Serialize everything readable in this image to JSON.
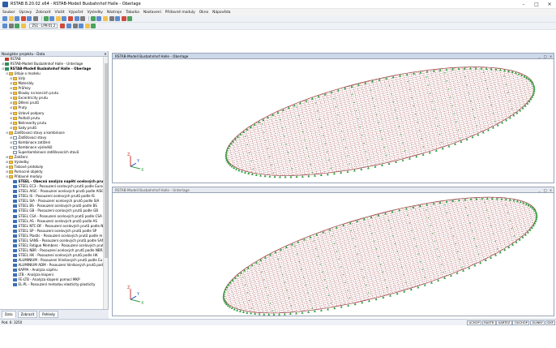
{
  "window": {
    "title": "RSTAB 8.20.02 x64 - RSTAB-Modell Busbahnhof Halle - Oberlage",
    "minimize": "–",
    "maximize": "□",
    "close": "✕"
  },
  "menu": [
    "Soubor",
    "Úpravy",
    "Zobrazit",
    "Vložit",
    "Výpočet",
    "Výsledky",
    "Nástroje",
    "Tabulka",
    "Nastavení",
    "Přídavné moduly",
    "Okno",
    "Nápověda"
  ],
  "toolbar": {
    "loadcase_combo": "ZS1 - LPK-01.2",
    "icon_colors_1": [
      "#5b8bd0",
      "#f2c14e",
      "#5b8bd0",
      "#d04a3a",
      "#5b8bd0",
      "#7b7b7b",
      "#4aa35c",
      "#5b8bd0",
      "#f2c14e",
      "#5b8bd0",
      "#d04a3a",
      "#5b8bd0",
      "#7b7b7b",
      "#4aa35c",
      "#5b8bd0",
      "#f2c14e",
      "#7b7b7b",
      "#5b8bd0",
      "#d04a3a",
      "#4aa35c"
    ],
    "icon_colors_2": [
      "#5b8bd0",
      "#7b7b7b",
      "#4aa35c",
      "#f2c14e",
      "#d04a3a",
      "#5b8bd0",
      "#7b7b7b",
      "#5b8bd0",
      "#f2c14e",
      "#4aa35c"
    ]
  },
  "navigator": {
    "title": "Navigátor projektu - Data",
    "close": "✕",
    "tabs": [
      "Data",
      "Zobrazit",
      "Pohledy"
    ],
    "items": [
      {
        "label": "RSTAB",
        "level": 0,
        "icon": "root",
        "exp": ""
      },
      {
        "label": "RSTAB-Modell Busbahnhof Halle - Unterlage",
        "level": 0,
        "icon": "model",
        "exp": "+"
      },
      {
        "label": "RSTAB-Modell Busbahnhof Halle - Oberlage",
        "level": 0,
        "icon": "model",
        "exp": "−",
        "bold": true
      },
      {
        "label": "Údaje o modelu",
        "level": 1,
        "icon": "folder",
        "exp": "−"
      },
      {
        "label": "Uzly",
        "level": 2,
        "icon": "folder",
        "exp": "+"
      },
      {
        "label": "Materiály",
        "level": 2,
        "icon": "folder",
        "exp": "+"
      },
      {
        "label": "Průřezy",
        "level": 2,
        "icon": "folder",
        "exp": "+"
      },
      {
        "label": "Klouby na koncích prutu",
        "level": 2,
        "icon": "folder",
        "exp": "+"
      },
      {
        "label": "Excentricity prutu",
        "level": 2,
        "icon": "folder",
        "exp": "+"
      },
      {
        "label": "Dělení prutů",
        "level": 2,
        "icon": "folder",
        "exp": "+"
      },
      {
        "label": "Pruty",
        "level": 2,
        "icon": "folder",
        "exp": "+"
      },
      {
        "label": "Uzlové podpory",
        "level": 2,
        "icon": "folder",
        "exp": "+"
      },
      {
        "label": "Podloží prutu",
        "level": 2,
        "icon": "folder",
        "exp": "+"
      },
      {
        "label": "Nelinearity prutu",
        "level": 2,
        "icon": "folder",
        "exp": "+"
      },
      {
        "label": "Sady prutů",
        "level": 2,
        "icon": "folder",
        "exp": "+"
      },
      {
        "label": "Zatěžovací stavy a kombinace",
        "level": 1,
        "icon": "folder",
        "exp": "−"
      },
      {
        "label": "Zatěžovací stavy",
        "level": 2,
        "icon": "page",
        "exp": "+"
      },
      {
        "label": "Kombinace zatížení",
        "level": 2,
        "icon": "page",
        "exp": "+"
      },
      {
        "label": "Kombinace výsledků",
        "level": 2,
        "icon": "page",
        "exp": "+"
      },
      {
        "label": "Superkombinace zatěžovacích stavů",
        "level": 2,
        "icon": "page",
        "exp": ""
      },
      {
        "label": "Zatížení",
        "level": 1,
        "icon": "folder",
        "exp": "+"
      },
      {
        "label": "Výsledky",
        "level": 1,
        "icon": "folder",
        "exp": "+"
      },
      {
        "label": "Tiskové protokoly",
        "level": 1,
        "icon": "folder",
        "exp": "+"
      },
      {
        "label": "Pomocné objekty",
        "level": 1,
        "icon": "folder",
        "exp": "+"
      },
      {
        "label": "Přídavné moduly",
        "level": 1,
        "icon": "folder",
        "exp": "−"
      },
      {
        "label": "STEEL - Obecná analýza napětí ocelových prutů",
        "level": 2,
        "icon": "module",
        "exp": "",
        "bold": true
      },
      {
        "label": "STEEL EC3 - Posouzení ocelových prutů podle Euroc",
        "level": 2,
        "icon": "module",
        "exp": ""
      },
      {
        "label": "STEEL AISC - Posouzení ocelových prutů podle AISC",
        "level": 2,
        "icon": "module",
        "exp": ""
      },
      {
        "label": "STEEL IS - Posouzení ocelových prutů podle IS",
        "level": 2,
        "icon": "module",
        "exp": ""
      },
      {
        "label": "STEEL SIA - Posouzení ocelových prutů podle SIA",
        "level": 2,
        "icon": "module",
        "exp": ""
      },
      {
        "label": "STEEL BS - Posouzení ocelových prutů podle BS",
        "level": 2,
        "icon": "module",
        "exp": ""
      },
      {
        "label": "STEEL GB - Posouzení ocelových prutů podle GB",
        "level": 2,
        "icon": "module",
        "exp": ""
      },
      {
        "label": "STEEL CSA - Posouzení ocelových prutů podle CSA",
        "level": 2,
        "icon": "module",
        "exp": ""
      },
      {
        "label": "STEEL AS - Posouzení ocelových prutů podle AS",
        "level": 2,
        "icon": "module",
        "exp": ""
      },
      {
        "label": "STEEL NTC-DF - Posouzení ocelových prutů podle N",
        "level": 2,
        "icon": "module",
        "exp": ""
      },
      {
        "label": "STEEL SP - Posouzení ocelových prutů podle SP",
        "level": 2,
        "icon": "module",
        "exp": ""
      },
      {
        "label": "STEEL Plastic - Posouzení ocelových prutů podle m",
        "level": 2,
        "icon": "module",
        "exp": ""
      },
      {
        "label": "STEEL SANS - Posouzení ocelových prutů podle SAN",
        "level": 2,
        "icon": "module",
        "exp": ""
      },
      {
        "label": "STEEL Fatigue Members - Posouzení ocelových prut",
        "level": 2,
        "icon": "module",
        "exp": ""
      },
      {
        "label": "STEEL NBR - Posouzení ocelových prutů podle NBR",
        "level": 2,
        "icon": "module",
        "exp": ""
      },
      {
        "label": "STEEL HK - Posouzení ocelových prutů podle HK",
        "level": 2,
        "icon": "module",
        "exp": ""
      },
      {
        "label": "ALUMINIUM - Posouzení hliníkových prutů podle Eu",
        "level": 2,
        "icon": "module",
        "exp": ""
      },
      {
        "label": "ALUMINIUM ADM - Posouzení hliníkových prutů podl",
        "level": 2,
        "icon": "module",
        "exp": ""
      },
      {
        "label": "KAPPA - Analýza vzpěru",
        "level": 2,
        "icon": "module",
        "exp": ""
      },
      {
        "label": "LTB - Analýza klopení",
        "level": 2,
        "icon": "module",
        "exp": ""
      },
      {
        "label": "FE-LTB - Analýza klopení pomocí MKP",
        "level": 2,
        "icon": "module",
        "exp": ""
      },
      {
        "label": "EL-PL - Posouzení metodou elasticity-plasticity",
        "level": 2,
        "icon": "module",
        "exp": ""
      }
    ]
  },
  "viewports": [
    {
      "title": "RSTAB-Modell Busbahnhof Halle - Oberlage",
      "active": true
    },
    {
      "title": "RSTAB-Modell Busbahnhof Halle - Unterlage",
      "active": false
    }
  ],
  "axes": {
    "x": "X",
    "y": "Y",
    "z": "Z"
  },
  "statusbar": {
    "left": "Pod. 6: 3250",
    "buttons": [
      "UCHOP",
      "RASTR",
      "KARTEZ",
      "OUCHOP",
      "GLINKY",
      "DXF"
    ]
  },
  "colors": {
    "frame_red": "#9b3b40",
    "support_green": "#2a9d3a",
    "axis_x": "#2e9e3f",
    "axis_y": "#2a4fbf",
    "axis_z": "#c9302c"
  }
}
